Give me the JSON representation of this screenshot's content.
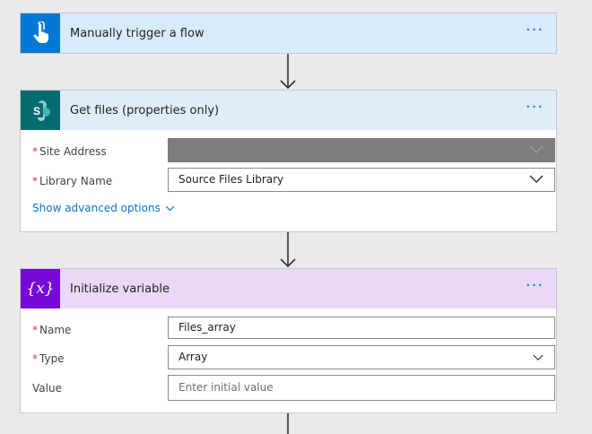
{
  "trigger": {
    "title": "Manually trigger a flow",
    "header_color": "#d8ebfd",
    "icon_color": "#0078d4",
    "icon": "hand-touch-icon"
  },
  "get_files": {
    "title": "Get files (properties only)",
    "header_color": "#e0ecf7",
    "icon_color": "#036c70",
    "icon": "sharepoint-icon",
    "fields": {
      "site_address": {
        "label": "Site Address",
        "required": true,
        "value": ""
      },
      "library_name": {
        "label": "Library Name",
        "required": true,
        "value": "Source Files Library"
      }
    },
    "advanced_label": "Show advanced options"
  },
  "init_var": {
    "title": "Initialize variable",
    "header_color": "#ead9f6",
    "icon_color": "#770bd6",
    "icon": "variable-icon",
    "icon_text": "{x}",
    "fields": {
      "name": {
        "label": "Name",
        "required": true,
        "value": "Files_array"
      },
      "type": {
        "label": "Type",
        "required": true,
        "value": "Array"
      },
      "value": {
        "label": "Value",
        "required": false,
        "placeholder": "Enter initial value"
      }
    }
  },
  "required_marker": "*",
  "more_label": "···"
}
